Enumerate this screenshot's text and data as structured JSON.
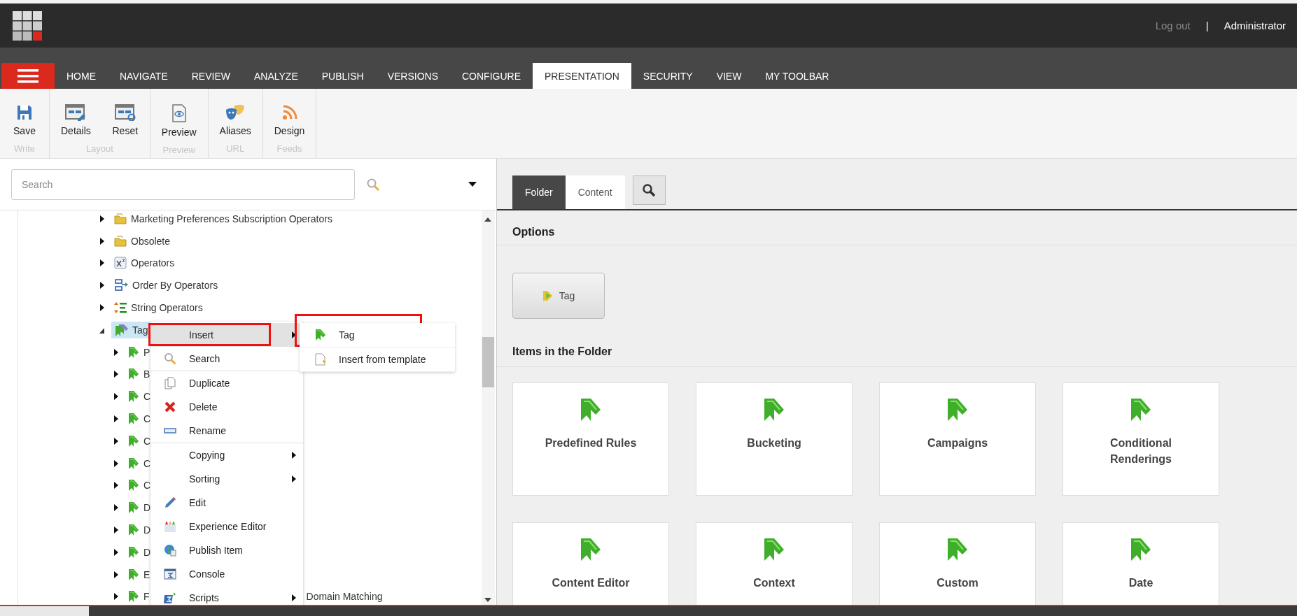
{
  "header": {
    "logout": "Log out",
    "separator": "|",
    "user": "Administrator"
  },
  "tabs": [
    {
      "label": "HOME",
      "selected": false
    },
    {
      "label": "NAVIGATE",
      "selected": false
    },
    {
      "label": "REVIEW",
      "selected": false
    },
    {
      "label": "ANALYZE",
      "selected": false
    },
    {
      "label": "PUBLISH",
      "selected": false
    },
    {
      "label": "VERSIONS",
      "selected": false
    },
    {
      "label": "CONFIGURE",
      "selected": false
    },
    {
      "label": "PRESENTATION",
      "selected": true
    },
    {
      "label": "SECURITY",
      "selected": false
    },
    {
      "label": "VIEW",
      "selected": false
    },
    {
      "label": "MY TOOLBAR",
      "selected": false
    }
  ],
  "ribbon": [
    {
      "group": "Write",
      "buttons": [
        {
          "label": "Save",
          "kind": "save"
        }
      ]
    },
    {
      "group": "Layout",
      "buttons": [
        {
          "label": "Details",
          "kind": "details"
        },
        {
          "label": "Reset",
          "kind": "reset"
        }
      ]
    },
    {
      "group": "Preview",
      "buttons": [
        {
          "label": "Preview",
          "kind": "preview"
        }
      ]
    },
    {
      "group": "URL",
      "buttons": [
        {
          "label": "Aliases",
          "kind": "aliases"
        }
      ]
    },
    {
      "group": "Feeds",
      "buttons": [
        {
          "label": "Design",
          "kind": "design"
        }
      ]
    }
  ],
  "search": {
    "placeholder": "Search"
  },
  "tree": [
    {
      "label": "Marketing Preferences Subscription Operators",
      "kind": "folder",
      "expanded": false,
      "selected": false
    },
    {
      "label": "Obsolete",
      "kind": "folder",
      "expanded": false,
      "selected": false
    },
    {
      "label": "Operators",
      "kind": "operators",
      "expanded": false,
      "selected": false
    },
    {
      "label": "Order By Operators",
      "kind": "order-by",
      "expanded": false,
      "selected": false
    },
    {
      "label": "String Operators",
      "kind": "string-operators",
      "expanded": false,
      "selected": false
    },
    {
      "label": "Tag",
      "kind": "tag-folder",
      "expanded": true,
      "selected": true,
      "children": [
        {
          "label": "P",
          "kind": "tag",
          "expanded": false,
          "selected": false
        },
        {
          "label": "B",
          "kind": "tag",
          "expanded": false,
          "selected": false
        },
        {
          "label": "C",
          "kind": "tag",
          "expanded": false,
          "selected": false
        },
        {
          "label": "C",
          "kind": "tag",
          "expanded": false,
          "selected": false
        },
        {
          "label": "C",
          "kind": "tag",
          "expanded": false,
          "selected": false
        },
        {
          "label": "C",
          "kind": "tag",
          "expanded": false,
          "selected": false
        },
        {
          "label": "C",
          "kind": "tag",
          "expanded": false,
          "selected": false
        },
        {
          "label": "D",
          "kind": "tag",
          "expanded": false,
          "selected": false
        },
        {
          "label": "D",
          "kind": "tag",
          "expanded": false,
          "selected": false
        },
        {
          "label": "D",
          "kind": "tag",
          "expanded": false,
          "selected": false
        },
        {
          "label": "E",
          "kind": "tag",
          "expanded": false,
          "selected": false
        },
        {
          "label": "F",
          "tail": "Domain Matching",
          "kind": "tag",
          "expanded": false,
          "selected": false
        }
      ]
    }
  ],
  "context_menu": [
    {
      "label": "Insert",
      "kind": "none",
      "submenu": true,
      "highlighted": true,
      "annotated": true
    },
    {
      "label": "Search",
      "kind": "search",
      "submenu": false,
      "highlighted": false,
      "annotated": false,
      "divider_after": true
    },
    {
      "label": "Duplicate",
      "kind": "duplicate",
      "submenu": false,
      "highlighted": false,
      "annotated": false
    },
    {
      "label": "Delete",
      "kind": "delete",
      "submenu": false,
      "highlighted": false,
      "annotated": false
    },
    {
      "label": "Rename",
      "kind": "rename",
      "submenu": false,
      "highlighted": false,
      "annotated": false,
      "divider_after": true
    },
    {
      "label": "Copying",
      "kind": "none",
      "submenu": true,
      "highlighted": false,
      "annotated": false
    },
    {
      "label": "Sorting",
      "kind": "none",
      "submenu": true,
      "highlighted": false,
      "annotated": false
    },
    {
      "label": "Edit",
      "kind": "edit",
      "submenu": false,
      "highlighted": false,
      "annotated": false
    },
    {
      "label": "Experience Editor",
      "kind": "experience-editor",
      "submenu": false,
      "highlighted": false,
      "annotated": false
    },
    {
      "label": "Publish Item",
      "kind": "publish",
      "submenu": false,
      "highlighted": false,
      "annotated": false
    },
    {
      "label": "Console",
      "kind": "console",
      "submenu": false,
      "highlighted": false,
      "annotated": false
    },
    {
      "label": "Scripts",
      "kind": "scripts",
      "submenu": true,
      "highlighted": false,
      "annotated": false
    }
  ],
  "submenu": [
    {
      "label": "Tag",
      "kind": "tag",
      "annotated": true
    },
    {
      "label": "Insert from template",
      "kind": "template",
      "annotated": false
    }
  ],
  "editor_tabs": [
    {
      "label": "Folder",
      "selected": true
    },
    {
      "label": "Content",
      "selected": false
    }
  ],
  "options": {
    "title": "Options",
    "buttons": [
      {
        "label": "Tag"
      }
    ]
  },
  "folder_items": {
    "title": "Items in the Folder",
    "items": [
      {
        "label": "Predefined Rules"
      },
      {
        "label": "Bucketing"
      },
      {
        "label": "Campaigns"
      },
      {
        "label": "Conditional Renderings"
      },
      {
        "label": "Content Editor"
      },
      {
        "label": "Context"
      },
      {
        "label": "Custom"
      },
      {
        "label": "Date"
      }
    ]
  }
}
